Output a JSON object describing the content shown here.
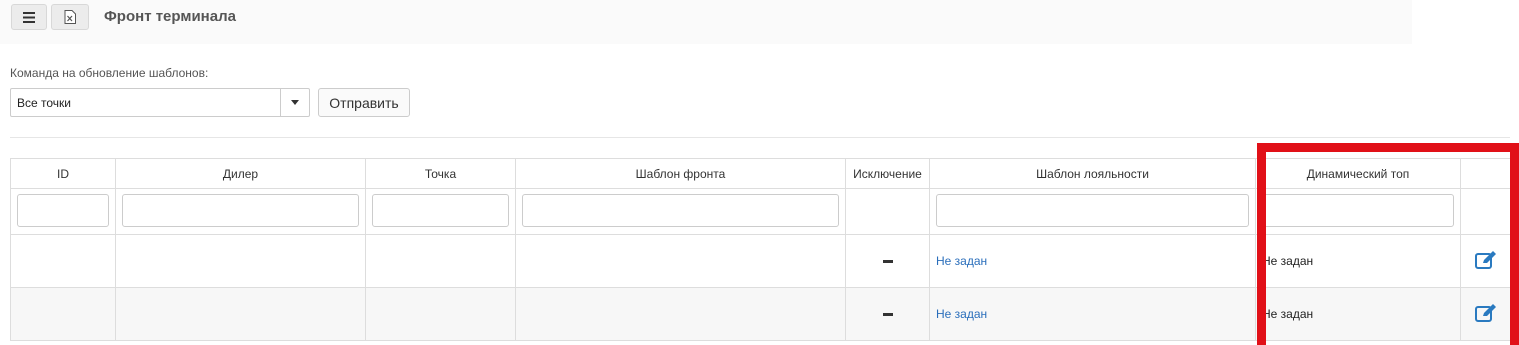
{
  "header": {
    "title": "Фронт терминала",
    "menu_icon": "hamburger-icon",
    "export_icon": "excel-export-icon"
  },
  "command": {
    "label": "Команда на обновление шаблонов:",
    "selected": "Все точки",
    "send_label": "Отправить"
  },
  "table": {
    "columns": [
      "ID",
      "Дилер",
      "Точка",
      "Шаблон фронта",
      "Исключение",
      "Шаблон лояльности",
      "Динамический топ",
      ""
    ],
    "rows": [
      {
        "id": "",
        "dealer": "",
        "point": "",
        "front_template": "",
        "exclusion": "–",
        "loyalty_template": "Не задан",
        "dynamic_top": "Не задан"
      },
      {
        "id": "",
        "dealer": "",
        "point": "",
        "front_template": "",
        "exclusion": "–",
        "loyalty_template": "Не задан",
        "dynamic_top": "Не задан"
      }
    ]
  },
  "colors": {
    "link": "#2a6ebb",
    "highlight": "#e11018",
    "edit_icon": "#2a7ac0"
  }
}
